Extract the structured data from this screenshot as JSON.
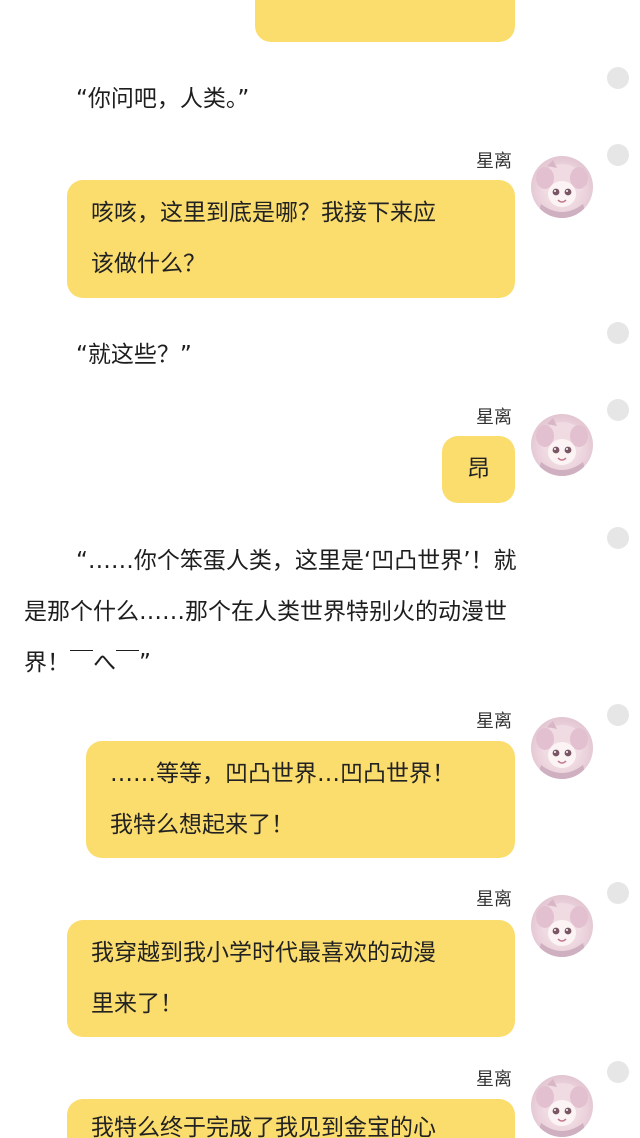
{
  "speaker_name": "星离",
  "messages": [
    {
      "type": "bubble",
      "lines": []
    },
    {
      "type": "narration",
      "lines": [
        "“你问吧，人类。”"
      ]
    },
    {
      "type": "bubble",
      "speaker": "星离",
      "lines": [
        "咳咳，这里到底是哪？我接下来应",
        "该做什么？"
      ]
    },
    {
      "type": "narration",
      "lines": [
        "“就这些？”"
      ]
    },
    {
      "type": "bubble",
      "speaker": "星离",
      "lines": [
        "昂"
      ]
    },
    {
      "type": "narration",
      "lines": [
        "“……你个笨蛋人类，这里是‘凹凸世界’！就",
        "是那个什么……那个在人类世界特别火的动漫世",
        "界！￣へ￣”"
      ]
    },
    {
      "type": "bubble",
      "speaker": "星离",
      "lines": [
        "……等等，凹凸世界…凹凸世界！",
        "我特么想起来了！"
      ]
    },
    {
      "type": "bubble",
      "speaker": "星离",
      "lines": [
        "我穿越到我小学时代最喜欢的动漫",
        "里来了！"
      ]
    },
    {
      "type": "bubble",
      "speaker": "星离",
      "lines": [
        "我特么终于完成了我见到金宝的心"
      ]
    }
  ]
}
